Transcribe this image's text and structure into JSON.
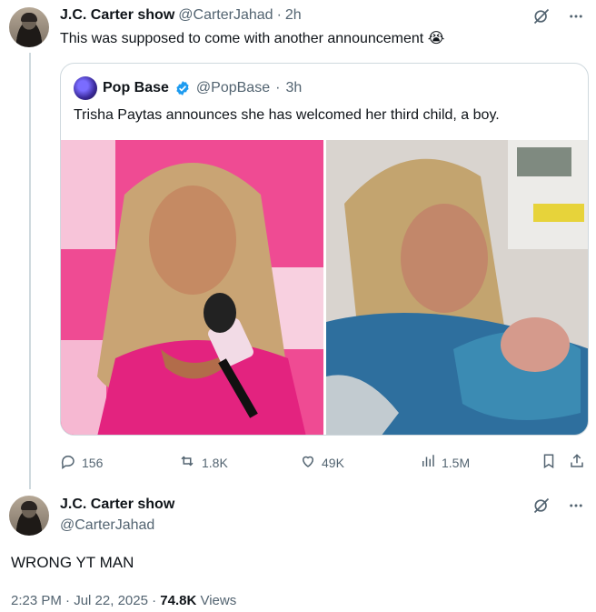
{
  "tweet1": {
    "author_name": "J.C. Carter show",
    "handle": "@CarterJahad",
    "separator": "·",
    "time": "2h",
    "text": "This was supposed to come with another announcement",
    "emoji": "😭"
  },
  "quote": {
    "author_name": "Pop Base",
    "handle": "@PopBase",
    "separator": "·",
    "time": "3h",
    "text": "Trisha Paytas announces she has welcomed her third child, a boy."
  },
  "actions": {
    "replies": "156",
    "reposts": "1.8K",
    "likes": "49K",
    "views": "1.5M"
  },
  "tweet2": {
    "author_name": "J.C. Carter show",
    "handle": "@CarterJahad",
    "text": "WRONG YT MAN",
    "time": "2:23 PM",
    "dot1": "·",
    "date": "Jul 22, 2025",
    "dot2": "·",
    "views_count": "74.8K",
    "views_label": " Views"
  },
  "icons": {
    "grok": "grok-icon",
    "more": "more-icon",
    "verified": "verified-badge-icon",
    "reply": "reply-icon",
    "repost": "repost-icon",
    "like": "like-icon",
    "views": "views-icon",
    "bookmark": "bookmark-icon",
    "share": "share-icon"
  },
  "colors": {
    "text": "#0f1419",
    "muted": "#536471",
    "border": "#cfd9de",
    "verified": "#1d9bf0"
  }
}
